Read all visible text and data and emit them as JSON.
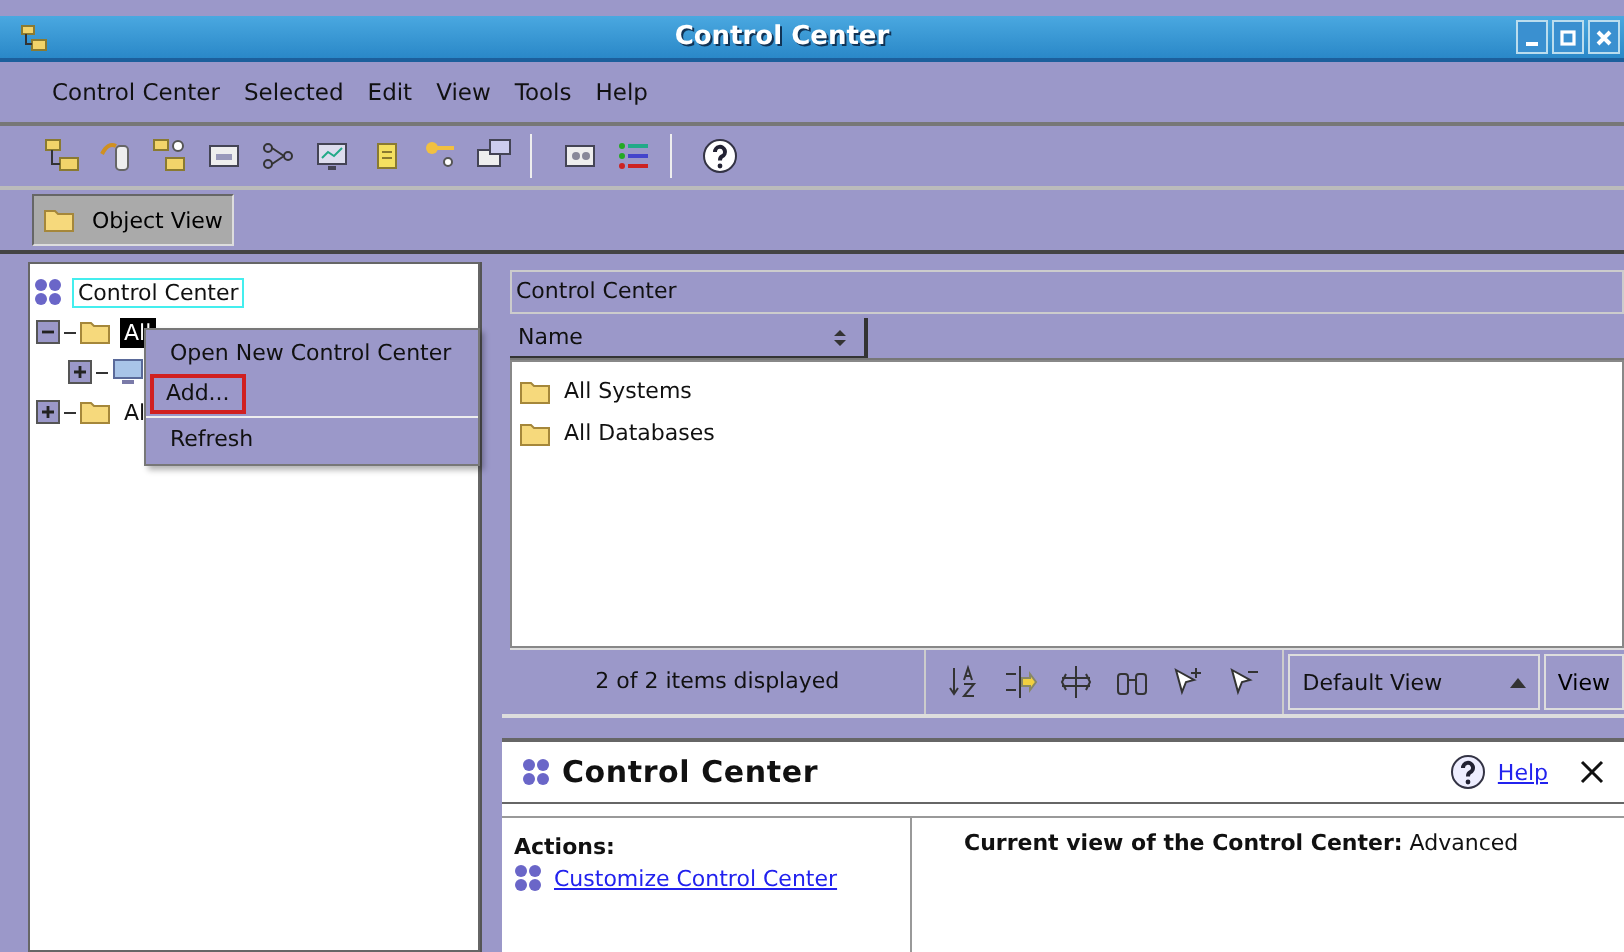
{
  "window": {
    "title": "Control Center"
  },
  "menu_bar": [
    {
      "label": "Control Center"
    },
    {
      "label": "Selected"
    },
    {
      "label": "Edit"
    },
    {
      "label": "View"
    },
    {
      "label": "Tools"
    },
    {
      "label": "Help"
    }
  ],
  "view_tabs": [
    {
      "label": "Object View",
      "selected": true
    }
  ],
  "tree": {
    "root": "Control Center",
    "children": [
      {
        "label": "All",
        "selected": true,
        "expanded": true,
        "children": [
          {
            "expanded": false
          }
        ]
      },
      {
        "label": "Al",
        "selected": false,
        "expanded": false
      }
    ]
  },
  "context_menu": [
    {
      "label": "Open New Control Center",
      "selected": false
    },
    {
      "label": "Add...",
      "selected": true
    },
    {
      "label": "Refresh",
      "selected": false
    }
  ],
  "contents": {
    "title": "Control Center",
    "columns": [
      "Name"
    ],
    "rows": [
      {
        "name": "All Systems"
      },
      {
        "name": "All Databases"
      }
    ],
    "status": "2 of 2 items displayed",
    "view_select": "Default View",
    "view_button": "View"
  },
  "details": {
    "title": "Control Center",
    "help": "Help",
    "actions_heading": "Actions:",
    "actions": [
      "Customize Control Center"
    ],
    "info_label": "Current view of the Control Center:",
    "info_value": "Advanced"
  }
}
